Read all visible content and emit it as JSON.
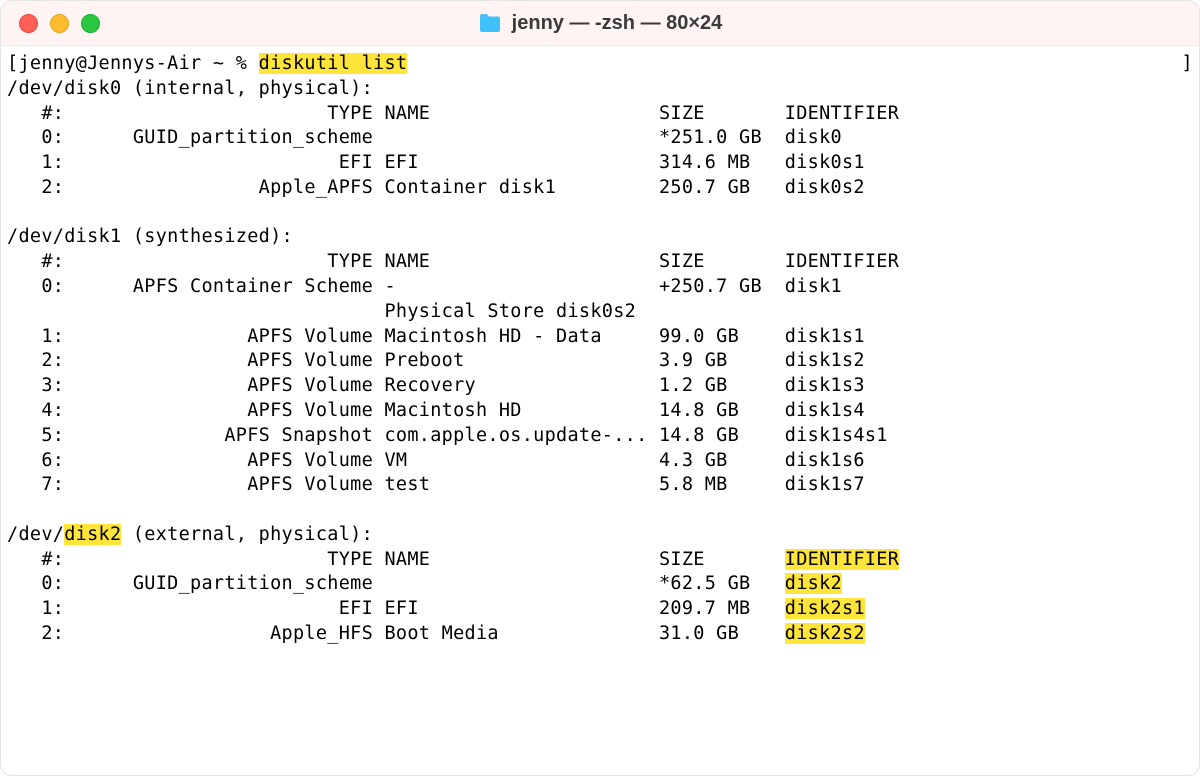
{
  "window": {
    "title": "jenny — -zsh — 80×24"
  },
  "prompt": {
    "left_bracket": "[",
    "user_host_path": "jenny@Jennys-Air ~ % ",
    "command": "diskutil list",
    "right_bracket": "]"
  },
  "disks": [
    {
      "header_prefix": "/dev/disk0 (internal, physical):",
      "device_hl": "",
      "columns": {
        "index": "   #:",
        "type": "                       TYPE",
        "name": "NAME",
        "size": "SIZE",
        "identifier": "IDENTIFIER"
      },
      "rows": [
        {
          "idx": "   0:",
          "type": "      GUID_partition_scheme",
          "name": "",
          "size": "*251.0 GB",
          "identifier": "disk0",
          "hl": false
        },
        {
          "idx": "   1:",
          "type": "                        EFI",
          "name": "EFI",
          "size": "314.6 MB",
          "identifier": "disk0s1",
          "hl": false
        },
        {
          "idx": "   2:",
          "type": "                 Apple_APFS",
          "name": "Container disk1",
          "size": "250.7 GB",
          "identifier": "disk0s2",
          "hl": false
        }
      ]
    },
    {
      "header_prefix": "/dev/disk1 (synthesized):",
      "device_hl": "",
      "columns": {
        "index": "   #:",
        "type": "                       TYPE",
        "name": "NAME",
        "size": "SIZE",
        "identifier": "IDENTIFIER"
      },
      "rows": [
        {
          "idx": "   0:",
          "type": "      APFS Container Scheme",
          "name": "-",
          "size": "+250.7 GB",
          "identifier": "disk1",
          "hl": false
        },
        {
          "idx": "",
          "type": "                           ",
          "name": "Physical Store disk0s2",
          "size": "",
          "identifier": "",
          "hl": false
        },
        {
          "idx": "   1:",
          "type": "                APFS Volume",
          "name": "Macintosh HD - Data",
          "size": "99.0 GB",
          "identifier": "disk1s1",
          "hl": false
        },
        {
          "idx": "   2:",
          "type": "                APFS Volume",
          "name": "Preboot",
          "size": "3.9 GB",
          "identifier": "disk1s2",
          "hl": false
        },
        {
          "idx": "   3:",
          "type": "                APFS Volume",
          "name": "Recovery",
          "size": "1.2 GB",
          "identifier": "disk1s3",
          "hl": false
        },
        {
          "idx": "   4:",
          "type": "                APFS Volume",
          "name": "Macintosh HD",
          "size": "14.8 GB",
          "identifier": "disk1s4",
          "hl": false
        },
        {
          "idx": "   5:",
          "type": "              APFS Snapshot",
          "name": "com.apple.os.update-...",
          "size": "14.8 GB",
          "identifier": "disk1s4s1",
          "hl": false
        },
        {
          "idx": "   6:",
          "type": "                APFS Volume",
          "name": "VM",
          "size": "4.3 GB",
          "identifier": "disk1s6",
          "hl": false
        },
        {
          "idx": "   7:",
          "type": "                APFS Volume",
          "name": "test",
          "size": "5.8 MB",
          "identifier": "disk1s7",
          "hl": false
        }
      ]
    },
    {
      "header_prefix": "/dev/",
      "device_hl": "disk2",
      "header_suffix": " (external, physical):",
      "columns": {
        "index": "   #:",
        "type": "                       TYPE",
        "name": "NAME",
        "size": "SIZE",
        "identifier": "IDENTIFIER",
        "identifier_hl": true
      },
      "rows": [
        {
          "idx": "   0:",
          "type": "      GUID_partition_scheme",
          "name": "",
          "size": "*62.5 GB",
          "identifier": "disk2",
          "hl": true
        },
        {
          "idx": "   1:",
          "type": "                        EFI",
          "name": "EFI",
          "size": "209.7 MB",
          "identifier": "disk2s1",
          "hl": true
        },
        {
          "idx": "   2:",
          "type": "                  Apple_HFS",
          "name": "Boot Media",
          "size": "31.0 GB",
          "identifier": "disk2s2",
          "hl": true
        }
      ]
    }
  ]
}
